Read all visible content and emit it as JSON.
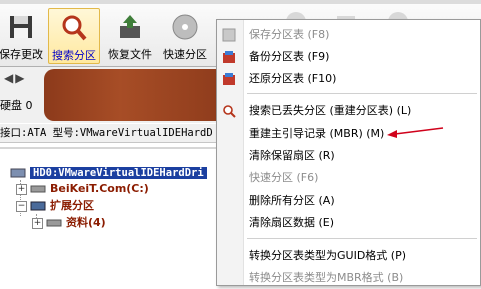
{
  "toolbar": {
    "buttons": [
      {
        "label": "保存更改",
        "icon": "save-icon"
      },
      {
        "label": "搜索分区",
        "icon": "magnifier-icon",
        "active": true
      },
      {
        "label": "恢复文件",
        "icon": "recover-file-icon"
      },
      {
        "label": "快速分区",
        "icon": "disk-icon"
      }
    ]
  },
  "disk": {
    "label": "硬盘 0",
    "interface": "接口:ATA  型号:VMwareVirtualIDEHardD"
  },
  "tree": {
    "root": "HD0:VMwareVirtualIDEHardDri",
    "c_drive": "BeiKeiT.Com(C:)",
    "extended": "扩展分区",
    "ziliao": "资料(4)"
  },
  "menu": {
    "items": [
      {
        "label": "保存分区表 (F8)",
        "disabled": true,
        "icon": "save-table-icon"
      },
      {
        "label": "备份分区表 (F9)",
        "disabled": false,
        "icon": "backup-icon"
      },
      {
        "label": "还原分区表 (F10)",
        "disabled": false,
        "icon": "restore-icon"
      },
      {
        "label": "搜索已丢失分区 (重建分区表) (L)",
        "disabled": false,
        "icon": "search-icon"
      },
      {
        "label": "重建主引导记录 (MBR) (M)",
        "disabled": false,
        "icon": ""
      },
      {
        "label": "清除保留扇区 (R)",
        "disabled": false,
        "icon": ""
      },
      {
        "label": "快速分区 (F6)",
        "disabled": true,
        "icon": ""
      },
      {
        "label": "删除所有分区 (A)",
        "disabled": false,
        "icon": ""
      },
      {
        "label": "清除扇区数据 (E)",
        "disabled": false,
        "icon": ""
      },
      {
        "label": "转换分区表类型为GUID格式  (P)",
        "disabled": false,
        "icon": ""
      },
      {
        "label": "转换分区表类型为MBR格式  (B)",
        "disabled": true,
        "icon": ""
      }
    ]
  },
  "colors": {
    "active_label": "#0000c8",
    "disk_bar": "#a74d26",
    "arrow": "#d0021b",
    "tree_root_bg": "#1b3fa0",
    "partition_text": "#8b1c00"
  }
}
